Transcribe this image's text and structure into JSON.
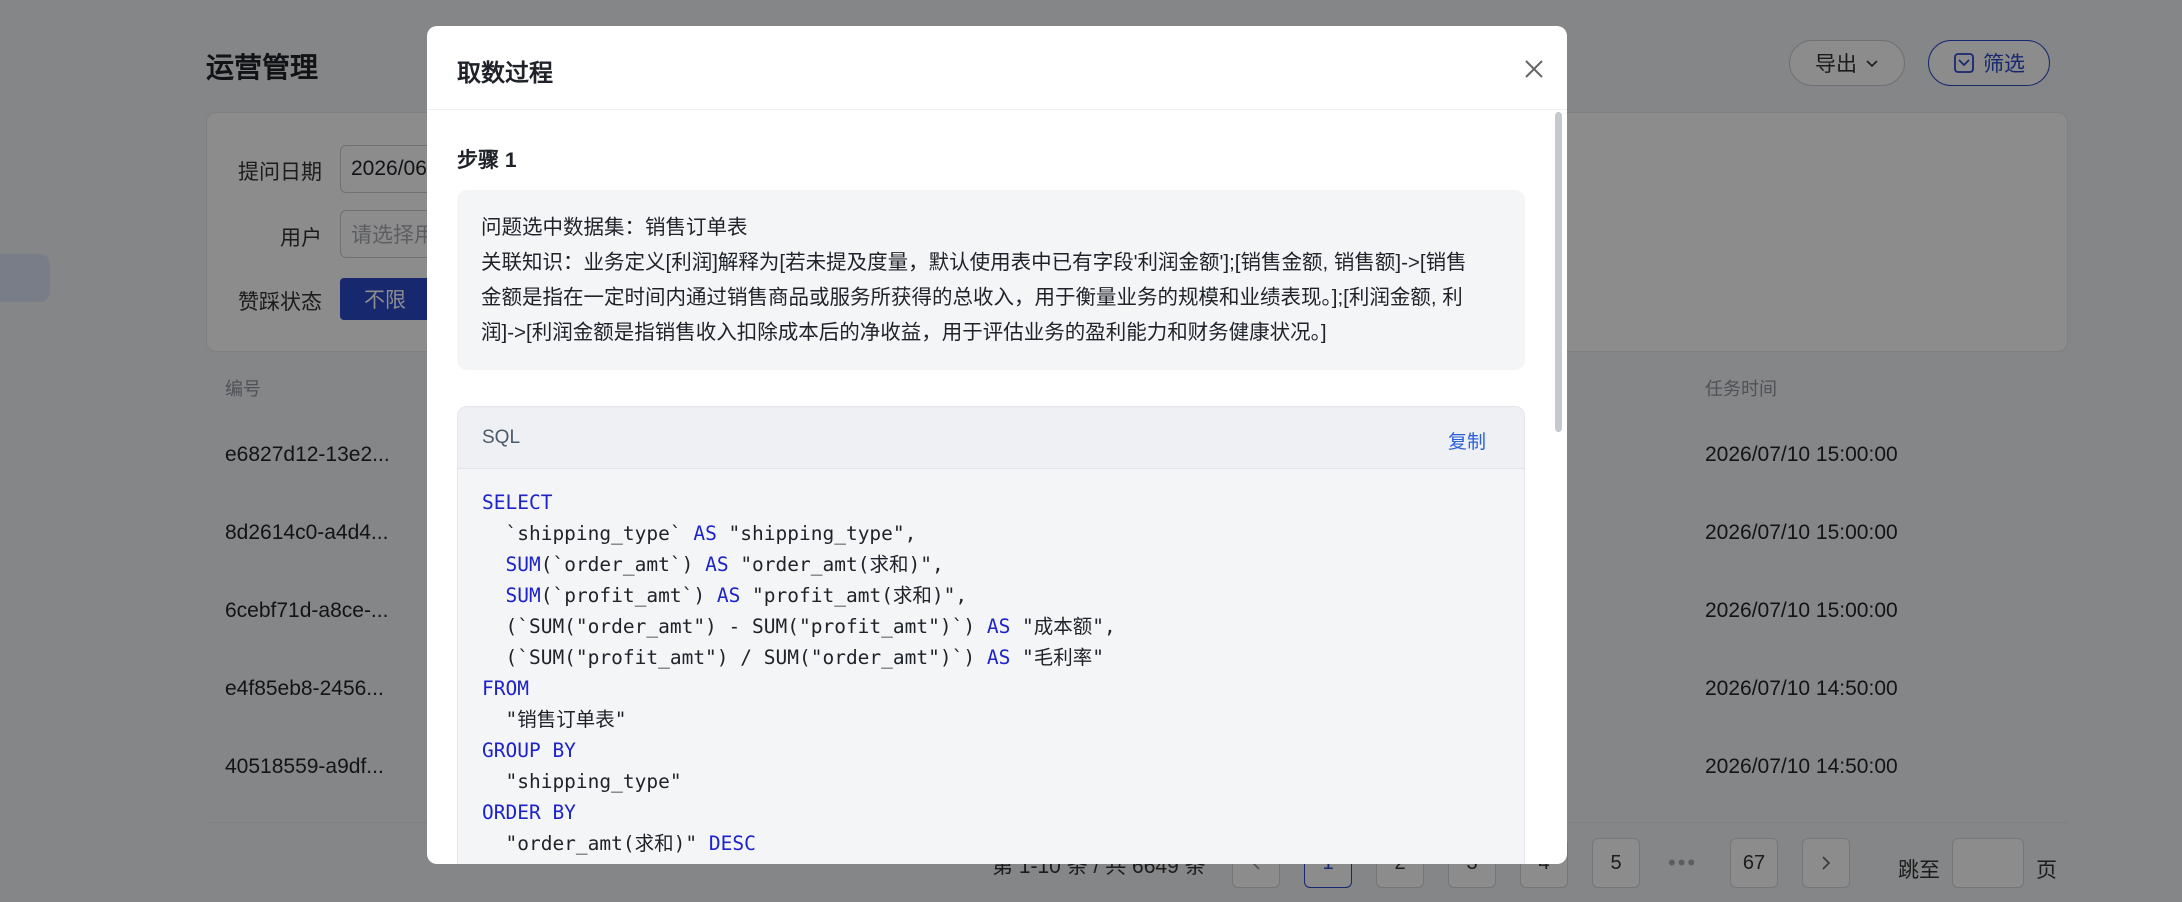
{
  "page": {
    "title": "运营管理",
    "export_label": "导出",
    "filter_label": "筛选",
    "filters": {
      "date_label": "提问日期",
      "date_value": "2026/06",
      "user_label": "用户",
      "user_placeholder": "请选择用",
      "like_label": "赞踩状态",
      "like_value": "不限"
    },
    "table": {
      "col_id": "编号",
      "col_time": "任务时间",
      "rows": [
        {
          "id": "e6827d12-13e2...",
          "time": "2026/07/10 15:00:00"
        },
        {
          "id": "8d2614c0-a4d4...",
          "time": "2026/07/10 15:00:00"
        },
        {
          "id": "6cebf71d-a8ce-...",
          "time": "2026/07/10 15:00:00"
        },
        {
          "id": "e4f85eb8-2456...",
          "time": "2026/07/10 14:50:00"
        },
        {
          "id": "40518559-a9df...",
          "time": "2026/07/10 14:50:00"
        }
      ]
    },
    "pagination": {
      "summary": "第 1-10 条 / 共 6649 条",
      "pages": [
        "1",
        "2",
        "3",
        "4",
        "5"
      ],
      "active_page": "1",
      "last_page": "67",
      "jump_label": "跳至",
      "page_suffix": "页"
    }
  },
  "modal": {
    "title": "取数过程",
    "step_title": "步骤 1",
    "info_line1": "问题选中数据集：销售订单表",
    "info_line2": "关联知识：业务定义[利润]解释为[若未提及度量，默认使用表中已有字段'利润金额'];[销售金额, 销售额]->[销售",
    "info_line3": "金额是指在一定时间内通过销售商品或服务所获得的总收入，用于衡量业务的规模和业绩表现。];[利润金额, 利",
    "info_line4": "润]->[利润金额是指销售收入扣除成本后的净收益，用于评估业务的盈利能力和财务健康状况。]",
    "code_lang": "SQL",
    "copy_label": "复制",
    "sql_lines": [
      [
        {
          "t": "SELECT",
          "kw": true
        }
      ],
      [
        {
          "t": "  `shipping_type` "
        },
        {
          "t": "AS",
          "kw": true
        },
        {
          "t": " \"shipping_type\","
        }
      ],
      [
        {
          "t": "  "
        },
        {
          "t": "SUM",
          "kw": true
        },
        {
          "t": "(`order_amt`) "
        },
        {
          "t": "AS",
          "kw": true
        },
        {
          "t": " \"order_amt(求和)\","
        }
      ],
      [
        {
          "t": "  "
        },
        {
          "t": "SUM",
          "kw": true
        },
        {
          "t": "(`profit_amt`) "
        },
        {
          "t": "AS",
          "kw": true
        },
        {
          "t": " \"profit_amt(求和)\","
        }
      ],
      [
        {
          "t": "  (`SUM(\"order_amt\") - SUM(\"profit_amt\")`) "
        },
        {
          "t": "AS",
          "kw": true
        },
        {
          "t": " \"成本额\","
        }
      ],
      [
        {
          "t": "  (`SUM(\"profit_amt\") / SUM(\"order_amt\")`) "
        },
        {
          "t": "AS",
          "kw": true
        },
        {
          "t": " \"毛利率\""
        }
      ],
      [
        {
          "t": "FROM",
          "kw": true
        }
      ],
      [
        {
          "t": "  \"销售订单表\""
        }
      ],
      [
        {
          "t": "GROUP BY",
          "kw": true
        }
      ],
      [
        {
          "t": "  \"shipping_type\""
        }
      ],
      [
        {
          "t": "ORDER BY",
          "kw": true
        }
      ],
      [
        {
          "t": "  \"order_amt(求和)\" "
        },
        {
          "t": "DESC",
          "kw": true
        }
      ]
    ]
  },
  "colors": {
    "primary": "#2b4acb",
    "keyword": "#1d22c9",
    "link": "#2b5fd9",
    "overlay": "rgba(0,0,0,0.45)"
  }
}
